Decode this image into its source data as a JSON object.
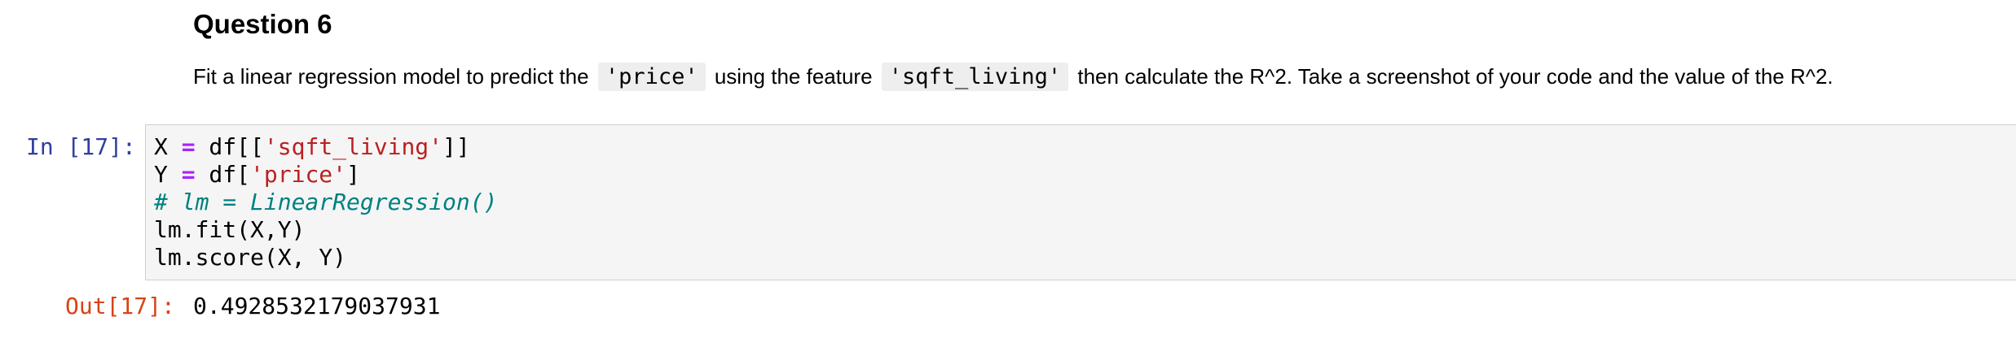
{
  "markdown_cell": {
    "title": "Question 6",
    "text_parts": {
      "p1": "Fit a linear regression model to predict the",
      "code1": "'price'",
      "p2": "using the feature",
      "code2": "'sqft_living'",
      "p3": "then calculate the R^2. Take a screenshot of your code and the value of the R^2."
    }
  },
  "code_cell": {
    "prompt": "In [17]:",
    "lines": [
      {
        "a": "X ",
        "op": "=",
        "b": " df[[",
        "str": "'sqft_living'",
        "c": "]]"
      },
      {
        "a": "Y ",
        "op": "=",
        "b": " df[",
        "str": "'price'",
        "c": "]"
      },
      {
        "comment": "# lm = LinearRegression()"
      },
      {
        "plain": "lm.fit(X,Y)"
      },
      {
        "plain": "lm.score(X, Y)"
      }
    ]
  },
  "output_cell": {
    "prompt": "Out[17]:",
    "value": "0.4928532179037931"
  },
  "colors": {
    "in_prompt": "#303f9f",
    "out_prompt": "#d84315",
    "string": "#ba2121",
    "operator": "#aa22ff",
    "comment": "#008080",
    "code_background": "#f5f5f5"
  }
}
